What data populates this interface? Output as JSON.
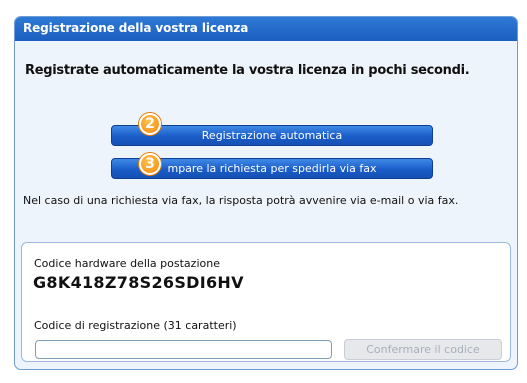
{
  "panel": {
    "title": "Registrazione della vostra licenza",
    "headline": "Registrate automaticamente la vostra licenza in pochi secondi.",
    "buttons": {
      "auto_label": "Registrazione automatica",
      "fax_label": "mpare la richiesta per spedirla via fax"
    },
    "step_badges": {
      "auto": "2",
      "fax": "3"
    },
    "fax_note": "Nel caso di una richiesta via fax, la risposta potrà avvenire via e-mail o via fax."
  },
  "hardware": {
    "label": "Codice hardware della postazione",
    "code": "G8K418Z78S26SDI6HV"
  },
  "registration": {
    "label": "Codice di registrazione (31 caratteri)",
    "input_value": "",
    "confirm_label": "Confermare il codice"
  },
  "colors": {
    "title_bar": "#1c5fc0",
    "button": "#1a5dc8",
    "badge": "#f48a10",
    "panel_bg": "#eef4fb"
  }
}
